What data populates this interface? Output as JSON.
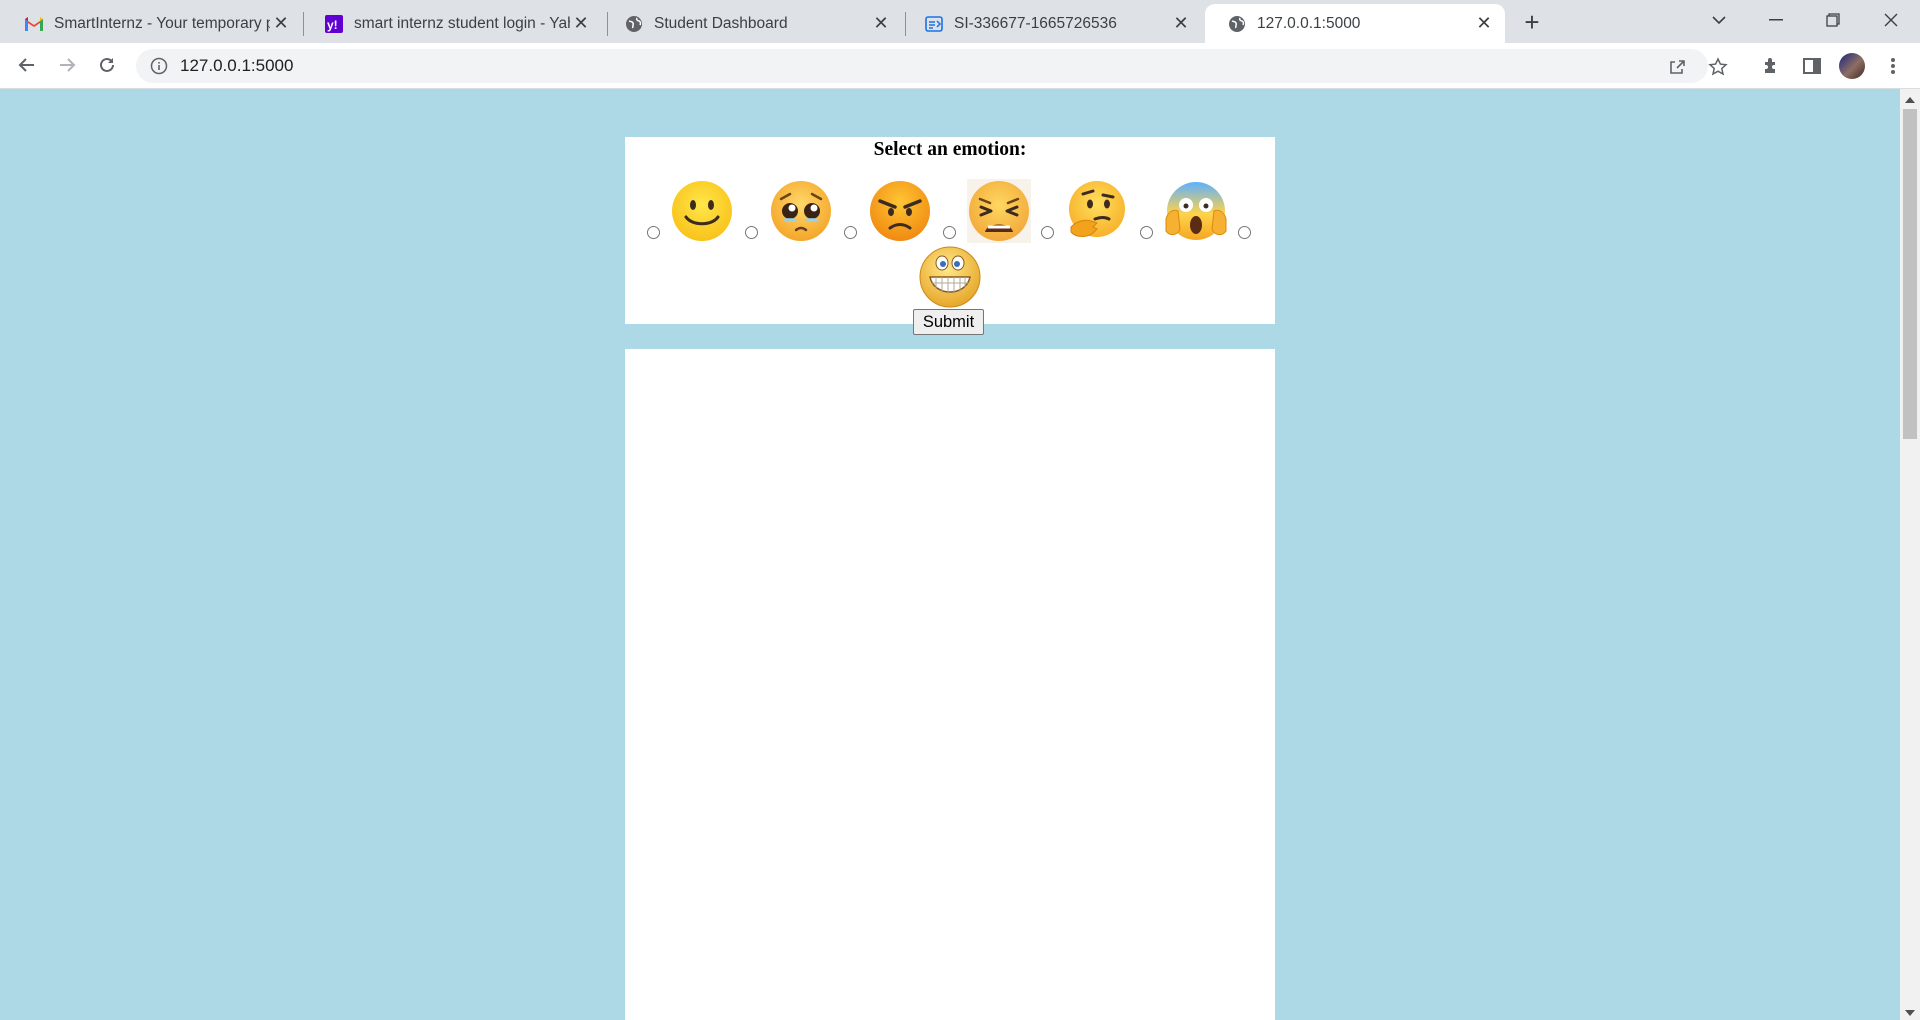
{
  "browser": {
    "tabs": [
      {
        "title": "SmartInternz - Your temporary p",
        "icon": "gmail-icon"
      },
      {
        "title": "smart internz student login - Yah",
        "icon": "yahoo-icon"
      },
      {
        "title": "Student Dashboard",
        "icon": "globe-icon"
      },
      {
        "title": "SI-336677-1665726536",
        "icon": "form-icon"
      },
      {
        "title": "127.0.0.1:5000",
        "icon": "globe-icon",
        "active": true
      }
    ],
    "url": "127.0.0.1:5000"
  },
  "page": {
    "background": "#add8e6",
    "heading": "Select an emotion:",
    "emotions": [
      "slightly-smiling",
      "pleading",
      "angry",
      "tired",
      "thinking",
      "screaming-in-fear",
      "grinning"
    ],
    "submit_label": "Submit"
  }
}
